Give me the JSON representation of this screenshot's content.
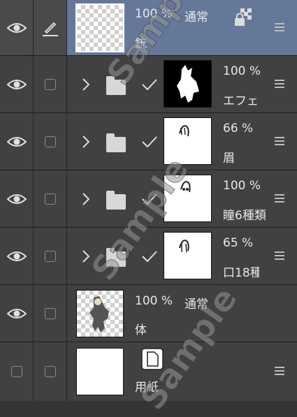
{
  "layers": [
    {
      "id": "gun",
      "opacity": "100 %",
      "blend": "通常",
      "name": "銃",
      "selected": true,
      "visible": true,
      "type": "raster"
    },
    {
      "id": "effects",
      "opacity": "100 %",
      "blend": "",
      "name": "エフェ",
      "selected": false,
      "visible": true,
      "type": "folder"
    },
    {
      "id": "eyebrows",
      "opacity": "66 %",
      "blend": "",
      "name": "眉",
      "selected": false,
      "visible": true,
      "type": "folder"
    },
    {
      "id": "eyes",
      "opacity": "100 %",
      "blend": "",
      "name": "瞳6種類",
      "selected": false,
      "visible": true,
      "type": "folder"
    },
    {
      "id": "mouth",
      "opacity": "65 %",
      "blend": "",
      "name": "口18種",
      "selected": false,
      "visible": true,
      "type": "folder"
    },
    {
      "id": "body",
      "opacity": "100 %",
      "blend": "通常",
      "name": "体",
      "selected": false,
      "visible": true,
      "type": "raster"
    },
    {
      "id": "paper",
      "opacity": "",
      "blend": "",
      "name": "用紙",
      "selected": false,
      "visible": false,
      "type": "paper"
    }
  ],
  "watermark": {
    "text": "Sample"
  },
  "colors": {
    "panel_bg": "#414141",
    "selected_bg": "#65789a",
    "text": "#e8e8e8"
  }
}
